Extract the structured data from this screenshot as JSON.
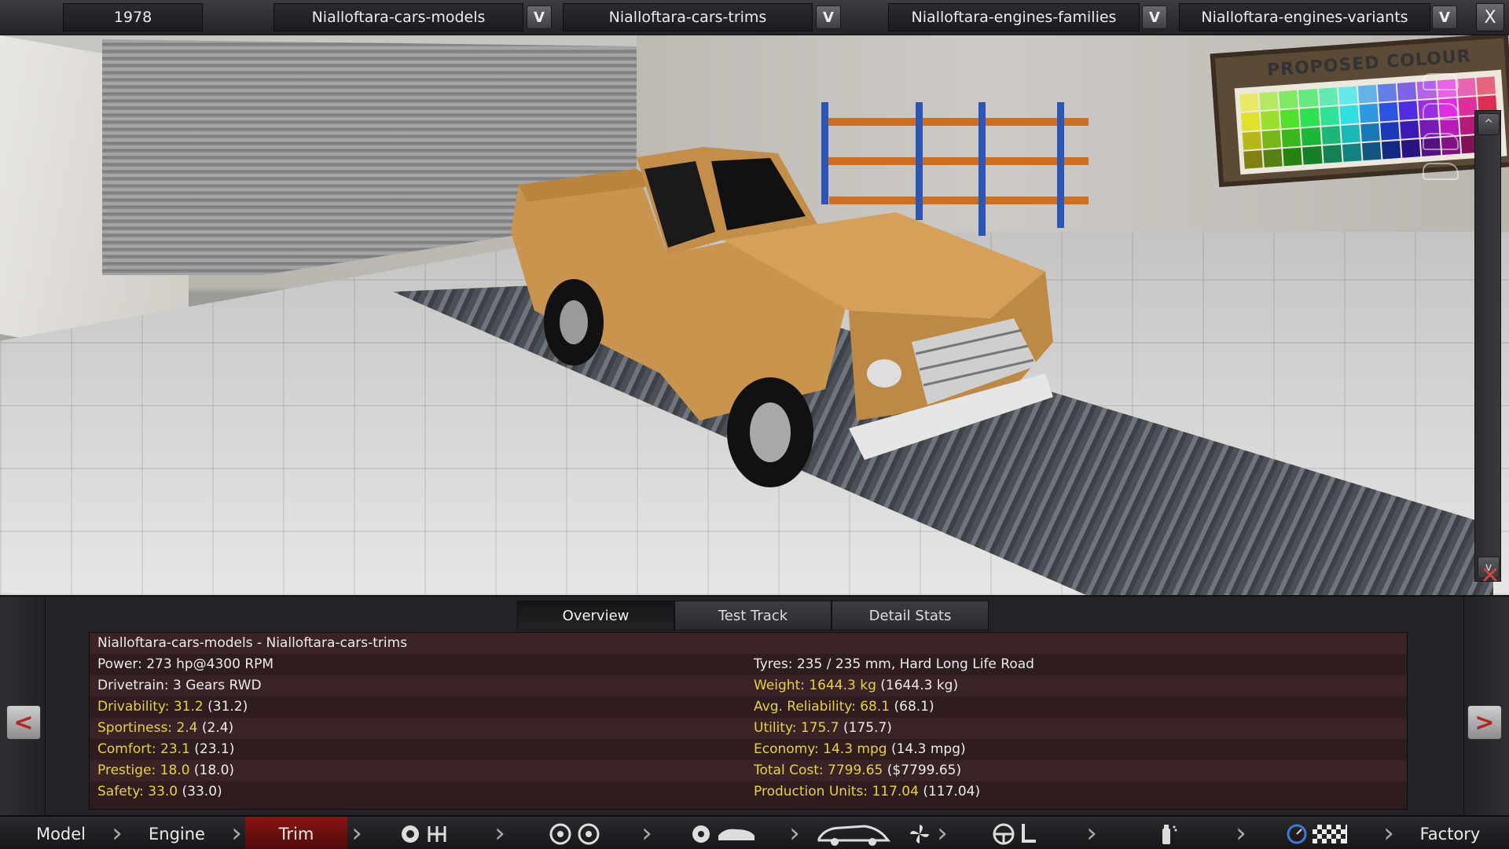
{
  "header": {
    "year": "1978",
    "dropdowns": [
      {
        "label": "Nialloftara-cars-models"
      },
      {
        "label": "Nialloftara-cars-trims"
      },
      {
        "label": "Nialloftara-engines-families"
      },
      {
        "label": "Nialloftara-engines-variants"
      }
    ],
    "dropdown_button": "V",
    "close": "X"
  },
  "scene": {
    "board_title": "PROPOSED COLOUR",
    "car_color": "#c8944e",
    "scroll_up": "^",
    "scroll_down": "v"
  },
  "lower": {
    "prev": "<",
    "next": ">",
    "tabs": [
      {
        "label": "Overview",
        "active": true
      },
      {
        "label": "Test Track",
        "active": false
      },
      {
        "label": "Detail Stats",
        "active": false
      }
    ],
    "title_line": "Nialloftara-cars-models - Nialloftara-cars-trims",
    "left": [
      {
        "plain": "Power: 273 hp@4300 RPM"
      },
      {
        "plain": "Drivetrain: 3 Gears RWD"
      },
      {
        "hl": "Drivability: 31.2",
        "plain": " (31.2)"
      },
      {
        "hl": "Sportiness: 2.4",
        "plain": " (2.4)"
      },
      {
        "hl": "Comfort: 23.1",
        "plain": " (23.1)"
      },
      {
        "hl": "Prestige: 18.0",
        "plain": " (18.0)"
      },
      {
        "hl": "Safety: 33.0",
        "plain": " (33.0)"
      }
    ],
    "right": [
      {
        "plain": "Tyres: 235 / 235 mm, Hard Long Life Road"
      },
      {
        "hl": "Weight: 1644.3 kg",
        "plain": " (1644.3 kg)"
      },
      {
        "hl": "Avg. Reliability: 68.1",
        "plain": " (68.1)"
      },
      {
        "hl": "Utility: 175.7",
        "plain": " (175.7)"
      },
      {
        "hl": "Economy: 14.3 mpg",
        "plain": " (14.3 mpg)"
      },
      {
        "hl": "Total Cost: 7799.65",
        "plain": " ($7799.65)"
      },
      {
        "hl": "Production Units: 117.04",
        "plain": " (117.04)"
      }
    ]
  },
  "bottom": {
    "steps": [
      "Model",
      "Engine",
      "Trim",
      "Factory"
    ],
    "active_step": "Trim",
    "icons": [
      "engine-gearbox-icon",
      "wheels-icon",
      "suspension-body-icon",
      "car-fan-icon",
      "steering-seat-icon",
      "paint-spray-icon",
      "testdrive-flag-icon"
    ]
  },
  "colors": {
    "accent_red": "#8a1414",
    "highlight": "#e5d23c"
  }
}
